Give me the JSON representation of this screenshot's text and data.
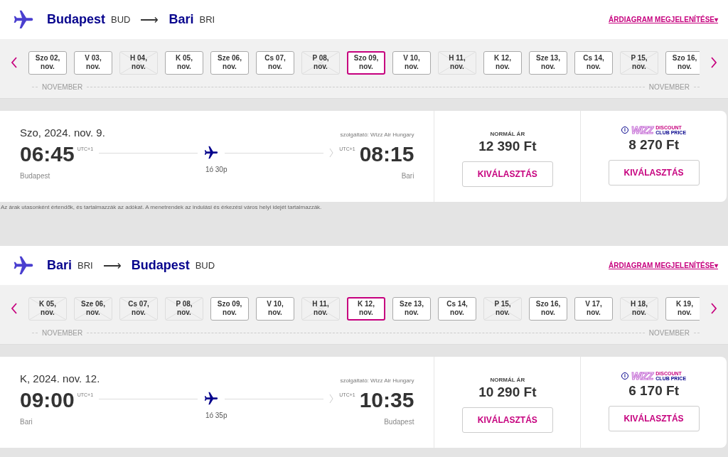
{
  "legs": [
    {
      "route": {
        "from_city": "Budapest",
        "from_code": "BUD",
        "arrow": "⟶",
        "to_city": "Bari",
        "to_code": "BRI"
      },
      "chart_link": "ÁRDIAGRAM MEGJELENÍTÉSE",
      "chart_caret": "▾",
      "dates": [
        {
          "label": "Szo 02,",
          "month": "nov.",
          "selected": false,
          "disabled": false
        },
        {
          "label": "V 03,",
          "month": "nov.",
          "selected": false,
          "disabled": false
        },
        {
          "label": "H 04,",
          "month": "nov.",
          "selected": false,
          "disabled": true
        },
        {
          "label": "K 05,",
          "month": "nov.",
          "selected": false,
          "disabled": false
        },
        {
          "label": "Sze 06,",
          "month": "nov.",
          "selected": false,
          "disabled": false
        },
        {
          "label": "Cs 07,",
          "month": "nov.",
          "selected": false,
          "disabled": false
        },
        {
          "label": "P 08,",
          "month": "nov.",
          "selected": false,
          "disabled": true
        },
        {
          "label": "Szo 09,",
          "month": "nov.",
          "selected": true,
          "disabled": false
        },
        {
          "label": "V 10,",
          "month": "nov.",
          "selected": false,
          "disabled": false
        },
        {
          "label": "H 11,",
          "month": "nov.",
          "selected": false,
          "disabled": true
        },
        {
          "label": "K 12,",
          "month": "nov.",
          "selected": false,
          "disabled": false
        },
        {
          "label": "Sze 13,",
          "month": "nov.",
          "selected": false,
          "disabled": false
        },
        {
          "label": "Cs 14,",
          "month": "nov.",
          "selected": false,
          "disabled": false
        },
        {
          "label": "P 15,",
          "month": "nov.",
          "selected": false,
          "disabled": true
        },
        {
          "label": "Szo 16,",
          "month": "nov.",
          "selected": false,
          "disabled": false
        }
      ],
      "month_left": "NOVEMBER",
      "month_right": "NOVEMBER",
      "flight": {
        "date": "Szo, 2024. nov. 9.",
        "operator": "szolgáltató: Wizz Air Hungary",
        "dep_time": "06:45",
        "dep_tz": "UTC+1",
        "arr_tz": "UTC+1",
        "arr_time": "08:15",
        "dep_city": "Budapest",
        "duration": "1ó 30p",
        "arr_city": "Bari"
      },
      "fares": [
        {
          "kind": "normal",
          "title": "NORMÁL ÁR",
          "price": "12 390 Ft",
          "button": "KIVÁLASZTÁS"
        },
        {
          "kind": "club",
          "logo_word": "WIZZ",
          "logo_top": "DISCOUNT",
          "logo_bottom": "CLUB PRICE",
          "info": "i",
          "price": "8 270 Ft",
          "button": "KIVÁLASZTÁS"
        }
      ],
      "note": "Az árak utasonként értendők, és tartalmazzák az adókat. A menetrendek az indulási és érkezési város helyi idejét tartalmazzák."
    },
    {
      "route": {
        "from_city": "Bari",
        "from_code": "BRI",
        "arrow": "⟶",
        "to_city": "Budapest",
        "to_code": "BUD"
      },
      "chart_link": "ÁRDIAGRAM MEGJELENÍTÉSE",
      "chart_caret": "▾",
      "dates": [
        {
          "label": "K 05,",
          "month": "nov.",
          "selected": false,
          "disabled": true
        },
        {
          "label": "Sze 06,",
          "month": "nov.",
          "selected": false,
          "disabled": true
        },
        {
          "label": "Cs 07,",
          "month": "nov.",
          "selected": false,
          "disabled": true
        },
        {
          "label": "P 08,",
          "month": "nov.",
          "selected": false,
          "disabled": true
        },
        {
          "label": "Szo 09,",
          "month": "nov.",
          "selected": false,
          "disabled": false
        },
        {
          "label": "V 10,",
          "month": "nov.",
          "selected": false,
          "disabled": false
        },
        {
          "label": "H 11,",
          "month": "nov.",
          "selected": false,
          "disabled": true
        },
        {
          "label": "K 12,",
          "month": "nov.",
          "selected": true,
          "disabled": false
        },
        {
          "label": "Sze 13,",
          "month": "nov.",
          "selected": false,
          "disabled": false
        },
        {
          "label": "Cs 14,",
          "month": "nov.",
          "selected": false,
          "disabled": false
        },
        {
          "label": "P 15,",
          "month": "nov.",
          "selected": false,
          "disabled": true
        },
        {
          "label": "Szo 16,",
          "month": "nov.",
          "selected": false,
          "disabled": false
        },
        {
          "label": "V 17,",
          "month": "nov.",
          "selected": false,
          "disabled": false
        },
        {
          "label": "H 18,",
          "month": "nov.",
          "selected": false,
          "disabled": true
        },
        {
          "label": "K 19,",
          "month": "nov.",
          "selected": false,
          "disabled": false
        }
      ],
      "month_left": "NOVEMBER",
      "month_right": "NOVEMBER",
      "flight": {
        "date": "K, 2024. nov. 12.",
        "operator": "szolgáltató: Wizz Air Hungary",
        "dep_time": "09:00",
        "dep_tz": "UTC+1",
        "arr_tz": "UTC+1",
        "arr_time": "10:35",
        "dep_city": "Bari",
        "duration": "1ó 35p",
        "arr_city": "Budapest"
      },
      "fares": [
        {
          "kind": "normal",
          "title": "NORMÁL ÁR",
          "price": "10 290 Ft",
          "button": "KIVÁLASZTÁS"
        },
        {
          "kind": "club",
          "logo_word": "WIZZ",
          "logo_top": "DISCOUNT",
          "logo_bottom": "CLUB PRICE",
          "info": "i",
          "price": "6 170 Ft",
          "button": "KIVÁLASZTÁS"
        }
      ]
    }
  ]
}
